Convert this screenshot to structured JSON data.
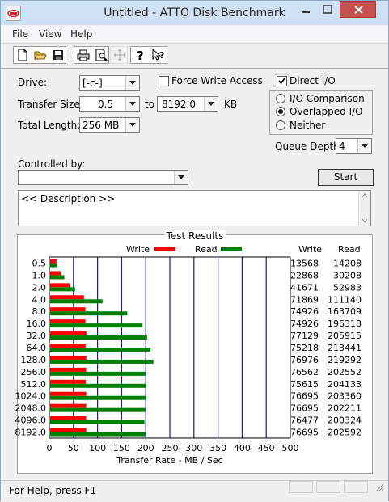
{
  "window": {
    "title": "Untitled - ATTO Disk Benchmark",
    "app_icon_text": "ATTO"
  },
  "menu": {
    "file": "File",
    "view": "View",
    "help": "Help"
  },
  "toolbar": {
    "items": [
      "new-doc-icon",
      "open-folder-icon",
      "save-icon",
      "print-icon",
      "print-preview-icon",
      "move-icon",
      "help-icon",
      "context-help-icon"
    ]
  },
  "settings": {
    "drive_label": "Drive:",
    "drive_value": "[-c-]",
    "transfer_size_label": "Transfer Size:",
    "transfer_from": "0.5",
    "to_label": "to",
    "transfer_to": "8192.0",
    "kb_label": "KB",
    "total_length_label": "Total Length:",
    "total_length_value": "256 MB",
    "force_write_label": "Force Write Access",
    "force_write_checked": false,
    "direct_io_label": "Direct I/O",
    "direct_io_checked": true,
    "io_comparison_label": "I/O Comparison",
    "overlapped_io_label": "Overlapped I/O",
    "neither_label": "Neither",
    "io_mode_selected": "Overlapped I/O",
    "queue_depth_label": "Queue Depth:",
    "queue_depth_value": "4",
    "controlled_by_label": "Controlled by:",
    "controlled_by_value": "",
    "start_label": "Start",
    "description": "<< Description >>"
  },
  "results": {
    "title": "Test Results",
    "write_legend": "Write",
    "read_legend": "Read",
    "write_col": "Write",
    "read_col": "Read",
    "write_color": "#ff0000",
    "read_color": "#008000"
  },
  "chart_data": {
    "type": "bar",
    "orientation": "horizontal",
    "xlabel": "Transfer Rate - MB / Sec",
    "xlim": [
      0,
      500
    ],
    "xticks": [
      0,
      50,
      100,
      150,
      200,
      250,
      300,
      350,
      400,
      450,
      500
    ],
    "categories": [
      "0.5",
      "1.0",
      "2.0",
      "4.0",
      "8.0",
      "16.0",
      "32.0",
      "64.0",
      "128.0",
      "256.0",
      "512.0",
      "1024.0",
      "2048.0",
      "4096.0",
      "8192.0"
    ],
    "series": [
      {
        "name": "Write",
        "unit_values": [
          13568,
          22868,
          41671,
          71869,
          74926,
          74926,
          77129,
          75218,
          76976,
          76562,
          75615,
          76695,
          76695,
          76477,
          76695
        ],
        "values_mb": [
          13.2,
          22.3,
          40.7,
          70.2,
          73.2,
          73.2,
          75.3,
          73.5,
          75.2,
          74.8,
          73.8,
          74.9,
          74.9,
          74.7,
          74.9
        ]
      },
      {
        "name": "Read",
        "unit_values": [
          14208,
          30208,
          52983,
          111140,
          163709,
          196318,
          205915,
          213441,
          219292,
          202552,
          204133,
          203360,
          202211,
          200324,
          202592
        ],
        "values_mb": [
          13.9,
          29.5,
          51.7,
          108.5,
          159.9,
          191.7,
          201.1,
          208.4,
          214.2,
          197.8,
          199.3,
          198.6,
          197.5,
          195.6,
          197.8
        ]
      }
    ]
  },
  "status": {
    "text": "For Help, press F1"
  }
}
